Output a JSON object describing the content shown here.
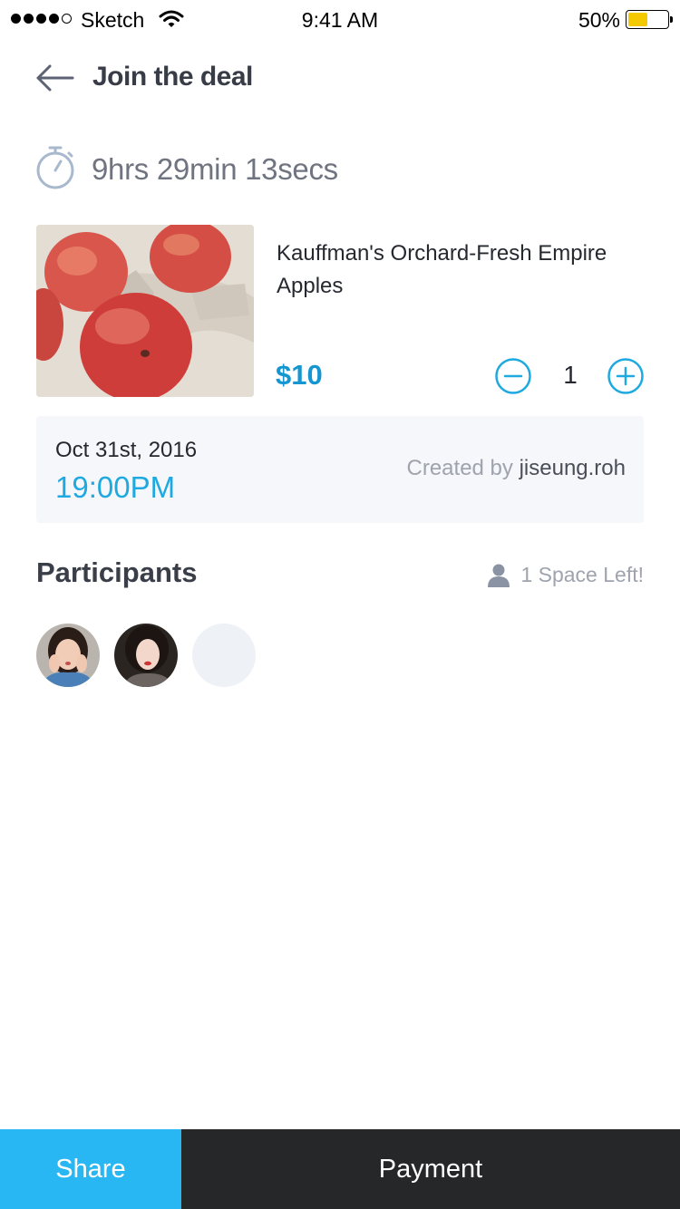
{
  "status_bar": {
    "carrier": "Sketch",
    "time": "9:41 AM",
    "battery_percent": "50%",
    "battery_level": 0.5,
    "battery_color": "#f5c900"
  },
  "header": {
    "title": "Join the deal",
    "back_icon": "arrow-left-icon"
  },
  "timer": {
    "icon": "stopwatch-icon",
    "remaining": "9hrs 29min 13secs"
  },
  "product": {
    "name": "Kauffman's Orchard-Fresh Empire Apples",
    "price": "$10",
    "quantity": "1",
    "price_color": "#1596d1"
  },
  "deal_info": {
    "date": "Oct 31st, 2016",
    "time": "19:00PM",
    "created_by_label": "Created by ",
    "creator": "jiseung.roh"
  },
  "participants": {
    "title": "Participants",
    "space_left": "1 Space Left!"
  },
  "bottom_bar": {
    "share_label": "Share",
    "payment_label": "Payment",
    "share_color": "#29b7f3",
    "payment_color": "#262729"
  }
}
